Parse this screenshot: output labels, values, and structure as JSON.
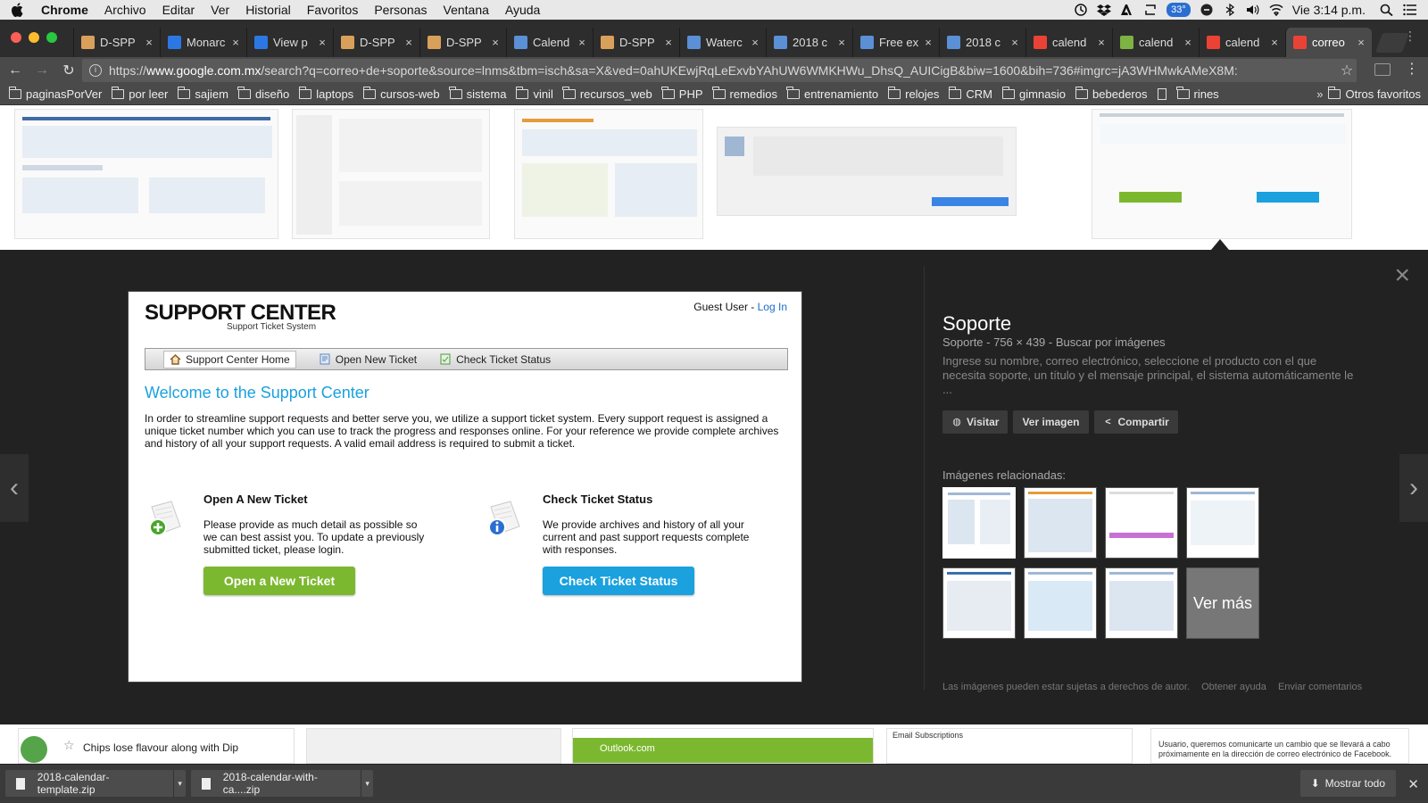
{
  "menubar": {
    "app": "Chrome",
    "items": [
      "Archivo",
      "Editar",
      "Ver",
      "Historial",
      "Favoritos",
      "Personas",
      "Ventana",
      "Ayuda"
    ],
    "battery": "33°",
    "clock": "Vie 3:14 p.m."
  },
  "tabs": [
    {
      "title": "D-SPP",
      "icon": "doc-icon",
      "color": "#d9a05b"
    },
    {
      "title": "Monarc",
      "icon": "ui-icon",
      "color": "#2b78e4"
    },
    {
      "title": "View p",
      "icon": "ui-icon",
      "color": "#2b78e4"
    },
    {
      "title": "D-SPP",
      "icon": "doc-icon",
      "color": "#d9a05b"
    },
    {
      "title": "D-SPP",
      "icon": "doc-icon",
      "color": "#d9a05b"
    },
    {
      "title": "Calend",
      "icon": "image-icon",
      "color": "#5b8fd6"
    },
    {
      "title": "D-SPP",
      "icon": "doc-icon",
      "color": "#d9a05b"
    },
    {
      "title": "Waterc",
      "icon": "image-icon",
      "color": "#5b8fd6"
    },
    {
      "title": "2018 c",
      "icon": "image-icon",
      "color": "#5b8fd6"
    },
    {
      "title": "Free ex",
      "icon": "image-icon",
      "color": "#5b8fd6"
    },
    {
      "title": "2018 c",
      "icon": "image-icon",
      "color": "#5b8fd6"
    },
    {
      "title": "calend",
      "icon": "google-icon",
      "color": "#ea4335"
    },
    {
      "title": "calend",
      "icon": "leaf-icon",
      "color": "#7cb342"
    },
    {
      "title": "calend",
      "icon": "google-icon",
      "color": "#ea4335"
    },
    {
      "title": "correo",
      "icon": "google-icon",
      "color": "#ea4335",
      "active": true
    }
  ],
  "address": {
    "prefix": "https://",
    "host": "www.google.com.mx",
    "path": "/search?q=correo+de+soporte&source=lnms&tbm=isch&sa=X&ved=0ahUKEwjRqLeExvbYAhUW6WMKHWu_DhsQ_AUICigB&biw=1600&bih=736#imgrc=jA3WHMwkAMeX8M:"
  },
  "bookmarks": {
    "folders": [
      "paginasPorVer",
      "por leer",
      "sajiem",
      "diseño",
      "laptops",
      "cursos-web",
      "sistema",
      "vinil",
      "recursos_web",
      "PHP",
      "remedios",
      "entrenamiento",
      "relojes",
      "CRM",
      "gimnasio",
      "bebederos"
    ],
    "after_page": "rines",
    "more": "»",
    "other": "Otros favoritos"
  },
  "preview": {
    "logo_title": "SUPPORT CENTER",
    "logo_subtitle": "Support Ticket System",
    "guest_text": "Guest User - ",
    "login_text": "Log In",
    "nav": [
      "Support Center Home",
      "Open New Ticket",
      "Check Ticket Status"
    ],
    "welcome": "Welcome to the Support Center",
    "intro": "In order to streamline support requests and better serve you, we utilize a support ticket system. Every support request is assigned a unique ticket number which you can use to track the progress and responses online. For your reference we provide complete archives and history of all your support requests. A valid email address is required to submit a ticket.",
    "open": {
      "heading": "Open A New Ticket",
      "text": "Please provide as much detail as possible so we can best assist you. To update a previously submitted ticket, please login.",
      "button": "Open a New Ticket",
      "color": "#7cb82f"
    },
    "check": {
      "heading": "Check Ticket Status",
      "text": "We provide archives and history of all your current and past support requests complete with responses.",
      "button": "Check Ticket Status",
      "color": "#1aa1de"
    }
  },
  "info": {
    "title": "Soporte",
    "meta": "Soporte - 756 × 439 - Buscar por imágenes",
    "description": "Ingrese su nombre, correo electrónico, seleccione el producto con el que necesita soporte, un título y el mensaje principal, el sistema automáticamente le ...",
    "actions": [
      "Visitar",
      "Ver imagen",
      "Compartir"
    ],
    "related_label": "Imágenes relacionadas:",
    "more_label": "Ver más",
    "footer": [
      "Las imágenes pueden estar sujetas a derechos de autor.",
      "Obtener ayuda",
      "Enviar comentarios"
    ]
  },
  "bottom_results": {
    "chips_text": "Chips lose flavour along with Dip",
    "outlook": "Outlook.com",
    "email_subscriptions": "Email Subscriptions",
    "facebook_text": "Usuario, queremos comunicarte un cambio que se llevará a cabo próximamente en la dirección de correo electrónico de Facebook."
  },
  "downloads": {
    "items": [
      "2018-calendar-template.zip",
      "2018-calendar-with-ca....zip"
    ],
    "show_all": "Mostrar todo"
  }
}
